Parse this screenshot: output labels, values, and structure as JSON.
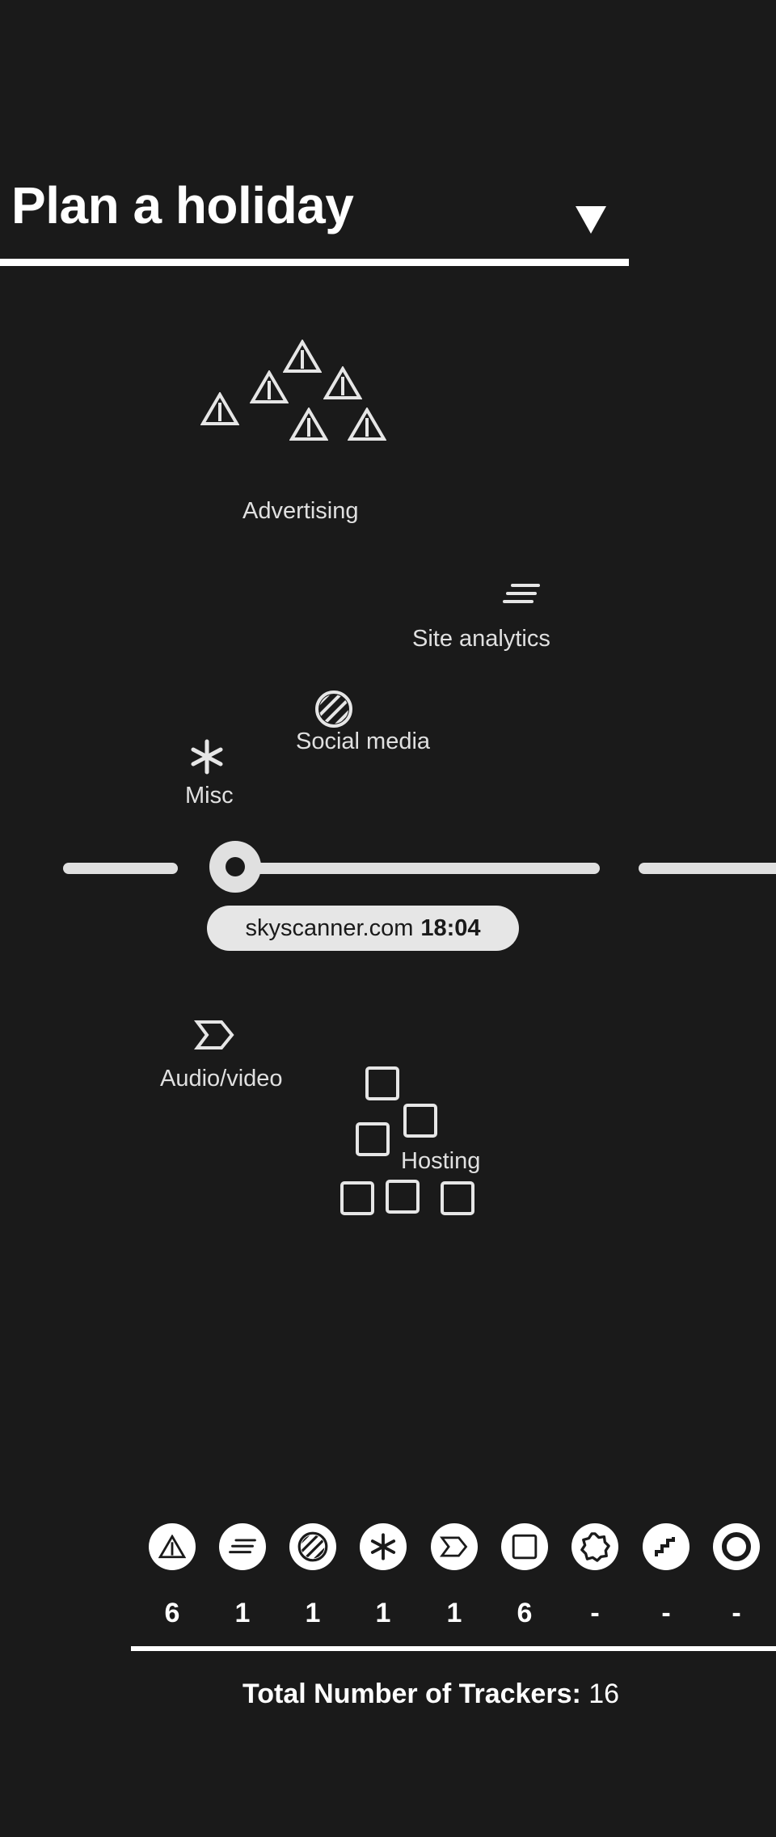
{
  "header": {
    "title": "Plan a holiday"
  },
  "categories": {
    "advertising": {
      "label": "Advertising",
      "icon": "triangle-warning-icon"
    },
    "site_analytics": {
      "label": "Site analytics",
      "icon": "lines-icon"
    },
    "social_media": {
      "label": "Social media",
      "icon": "hatched-circle-icon"
    },
    "misc": {
      "label": "Misc",
      "icon": "asterisk-icon"
    },
    "audio_video": {
      "label": "Audio/video",
      "icon": "chevron-tag-icon"
    },
    "hosting": {
      "label": "Hosting",
      "icon": "square-icon"
    }
  },
  "timeline": {
    "site": "skyscanner.com",
    "time": "18:04"
  },
  "legend": {
    "counts": [
      "6",
      "1",
      "1",
      "1",
      "1",
      "6",
      "-",
      "-",
      "-"
    ],
    "icons": [
      "triangle-warning-icon",
      "lines-icon",
      "hatched-circle-icon",
      "asterisk-icon",
      "chevron-tag-icon",
      "square-icon",
      "badge-icon",
      "stairs-icon",
      "ring-icon"
    ]
  },
  "footer": {
    "total_label": "Total Number of Trackers:",
    "total_value": "16"
  },
  "colors": {
    "background": "#1a1a1a",
    "foreground": "#ffffff",
    "muted": "#e0e0e0"
  }
}
